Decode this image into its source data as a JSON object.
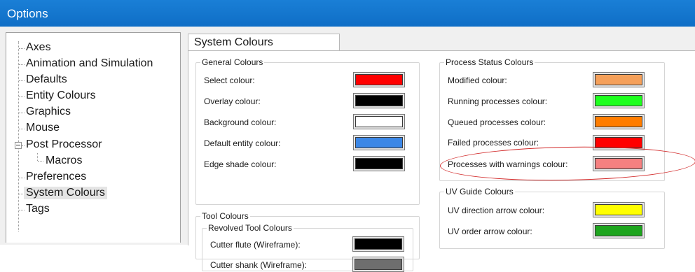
{
  "window": {
    "title": "Options"
  },
  "tree": {
    "items": [
      {
        "label": "Axes"
      },
      {
        "label": "Animation and Simulation"
      },
      {
        "label": "Defaults"
      },
      {
        "label": "Entity Colours"
      },
      {
        "label": "Graphics"
      },
      {
        "label": "Mouse"
      },
      {
        "label": "Post Processor"
      },
      {
        "label": "Macros"
      },
      {
        "label": "Preferences"
      },
      {
        "label": "System Colours"
      },
      {
        "label": "Tags"
      }
    ],
    "selected": "System Colours"
  },
  "tab": {
    "label": "System Colours"
  },
  "general": {
    "title": "General Colours",
    "rows": [
      {
        "label": "Select colour:",
        "color": "#ff0000"
      },
      {
        "label": "Overlay colour:",
        "color": "#000000"
      },
      {
        "label": "Background colour:",
        "color": "#ffffff"
      },
      {
        "label": "Default entity colour:",
        "color": "#3c87e6"
      },
      {
        "label": "Edge shade colour:",
        "color": "#000000"
      }
    ]
  },
  "process": {
    "title": "Process Status Colours",
    "rows": [
      {
        "label": "Modified colour:",
        "color": "#f5a05a"
      },
      {
        "label": "Running processes colour:",
        "color": "#1eff1e"
      },
      {
        "label": "Queued processes colour:",
        "color": "#ff7d00"
      },
      {
        "label": "Failed processes colour:",
        "color": "#ff0000"
      },
      {
        "label": "Processes with warnings colour:",
        "color": "#f58080"
      }
    ]
  },
  "tool": {
    "title": "Tool Colours",
    "subgroup": "Revolved Tool Colours",
    "rows": [
      {
        "label": "Cutter flute (Wireframe):",
        "color": "#000000"
      },
      {
        "label": "Cutter shank (Wireframe):",
        "color": "#6e6e6e"
      }
    ]
  },
  "uv": {
    "title": "UV Guide Colours",
    "rows": [
      {
        "label": "UV direction arrow colour:",
        "color": "#ffff00"
      },
      {
        "label": "UV order arrow colour:",
        "color": "#1ea51e"
      }
    ]
  },
  "highlight_color": "#d22a2a"
}
